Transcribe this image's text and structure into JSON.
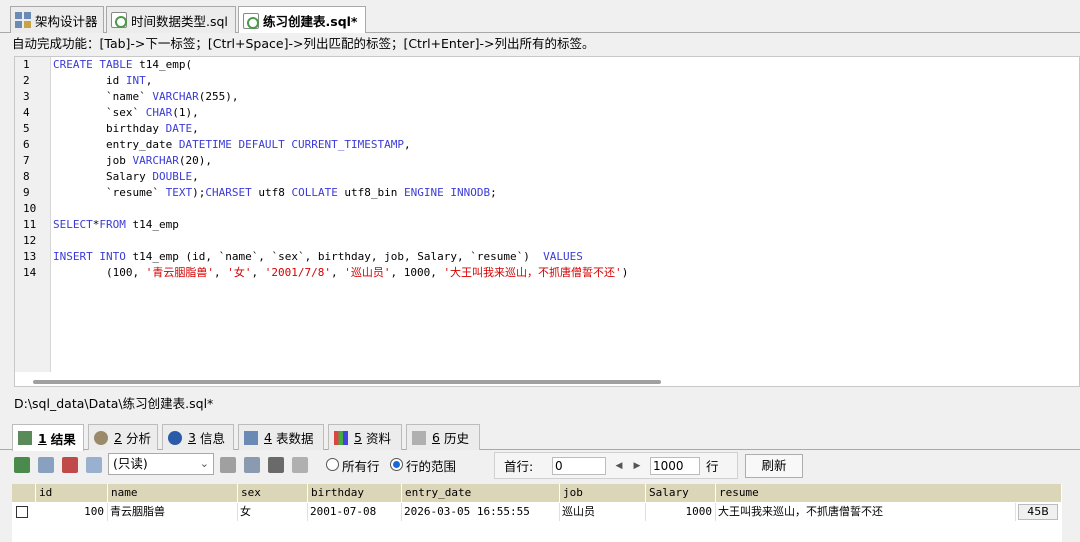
{
  "tabs": [
    {
      "label": "架构设计器"
    },
    {
      "label": "时间数据类型.sql"
    },
    {
      "label": "练习创建表.sql*"
    }
  ],
  "hint": "自动完成功能：[Tab]->下一标签；[Ctrl+Space]->列出匹配的标签；[Ctrl+Enter]->列出所有的标签。",
  "editor": {
    "line_numbers": [
      "1",
      "2",
      "3",
      "4",
      "5",
      "6",
      "7",
      "8",
      "9",
      "10",
      "11",
      "12",
      "13",
      "14"
    ]
  },
  "file_path": "D:\\sql_data\\Data\\练习创建表.sql*",
  "result_tabs": [
    {
      "num": "1",
      "label": "结果"
    },
    {
      "num": "2",
      "label": "分析"
    },
    {
      "num": "3",
      "label": "信息"
    },
    {
      "num": "4",
      "label": "表数据"
    },
    {
      "num": "5",
      "label": "资料"
    },
    {
      "num": "6",
      "label": "历史"
    }
  ],
  "toolbar": {
    "mode_select": "(只读)",
    "radio_all_rows": "所有行",
    "radio_range": "行的范围",
    "first_row_label": "首行:",
    "first_row_value": "0",
    "count_value": "1000",
    "row_unit": "行",
    "refresh": "刷新"
  },
  "grid": {
    "columns": [
      "id",
      "name",
      "sex",
      "birthday",
      "entry_date",
      "job",
      "Salary",
      "resume"
    ],
    "rows": [
      [
        "100",
        "青云胭脂兽",
        "女",
        "2001-07-08",
        "2026-03-05 16:55:55",
        "巡山员",
        "1000",
        "大王叫我来巡山，不抓唐僧誓不还"
      ]
    ],
    "resume_size": "45B"
  },
  "colors": {
    "keyword": "#3b3bd7",
    "string": "#d60000",
    "header_bg": "#dcd6b8"
  }
}
